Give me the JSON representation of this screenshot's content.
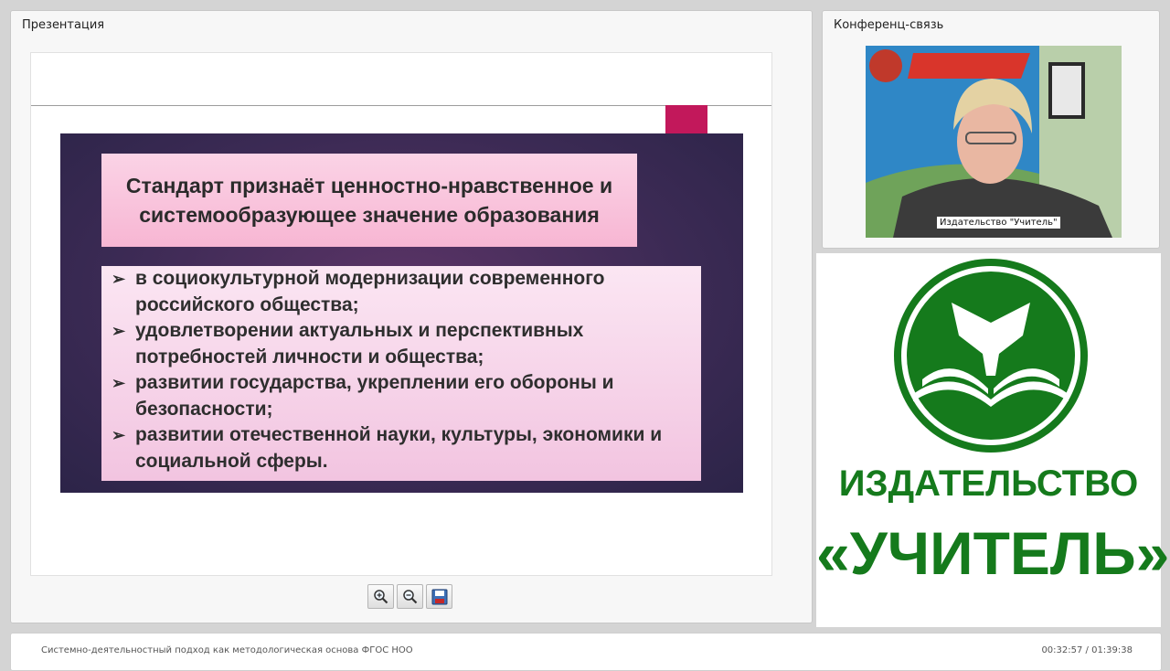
{
  "presentation": {
    "panel_title": "Презентация",
    "slide": {
      "title": "Стандарт признаёт ценностно-нравственное и системообразующее значение образования",
      "bullets": [
        "в социокультурной модернизации современного российского общества;",
        "удовлетворении актуальных и перспективных потребностей личности и общества;",
        "развитии государства, укреплении его обороны и безопасности;",
        "развитии отечественной науки, культуры, экономики и социальной сферы."
      ]
    },
    "toolbar": {
      "zoom_in": "zoom-in-icon",
      "zoom_out": "zoom-out-icon",
      "save": "floppy-disk-icon"
    }
  },
  "conference": {
    "panel_title": "Конференц-связь",
    "video_caption": "Издательство \"Учитель\""
  },
  "logo": {
    "line1": "ИЗДАТЕЛЬСТВО",
    "line2": "«УЧИТЕЛЬ»",
    "color": "#157a1c"
  },
  "footer": {
    "title": "Системно-деятельностный подход как методологическая основа ФГОС НОО",
    "time": "00:32:57 / 01:39:38"
  }
}
